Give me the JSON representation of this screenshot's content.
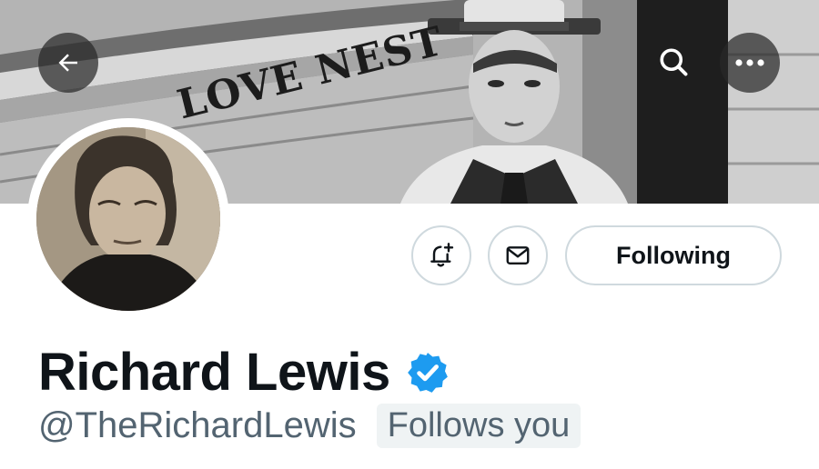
{
  "banner": {
    "sign_text": "LOVE NEST",
    "sign_text_partial": "L"
  },
  "nav": {
    "back_icon": "arrow-left-icon",
    "search_icon": "search-icon",
    "more_icon": "more-horizontal-icon"
  },
  "actions": {
    "notify_icon": "bell-plus-icon",
    "message_icon": "envelope-icon",
    "follow_label": "Following"
  },
  "profile": {
    "display_name": "Richard Lewis",
    "verified": true,
    "verified_color": "#1d9bf0",
    "handle": "@TheRichardLewis",
    "follows_you_label": "Follows you"
  },
  "colors": {
    "text_primary": "#0f1419",
    "text_secondary": "#536471",
    "border": "#cfd9de",
    "badge_bg": "#eff3f4"
  }
}
